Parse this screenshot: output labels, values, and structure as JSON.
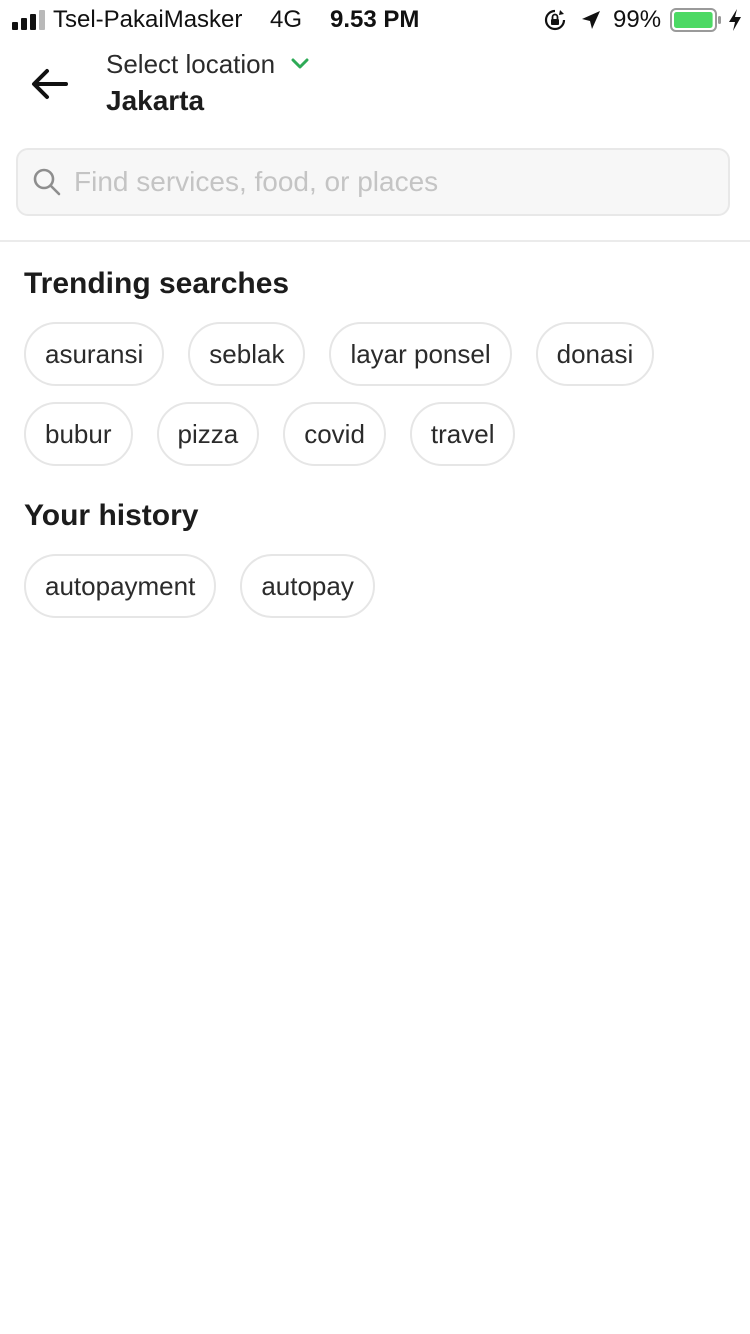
{
  "status_bar": {
    "carrier": "Tsel-PakaiMasker",
    "network": "4G",
    "time": "9.53 PM",
    "battery": "99%",
    "battery_level": 0.99,
    "battery_color": "#4cd964",
    "icons": [
      "signal-icon",
      "orientation-lock-icon",
      "location-arrow-icon",
      "battery-icon",
      "charging-icon"
    ]
  },
  "header": {
    "back_icon": "arrow-left-icon",
    "location_caption": "Select location",
    "location_name": "Jakarta",
    "chevron_color": "#2eaa56"
  },
  "search": {
    "placeholder": "Find services, food, or places",
    "value": ""
  },
  "trending": {
    "title": "Trending searches",
    "items": [
      "asuransi",
      "seblak",
      "layar ponsel",
      "donasi",
      "bubur",
      "pizza",
      "covid",
      "travel"
    ]
  },
  "history": {
    "title": "Your history",
    "items": [
      "autopayment",
      "autopay"
    ]
  }
}
